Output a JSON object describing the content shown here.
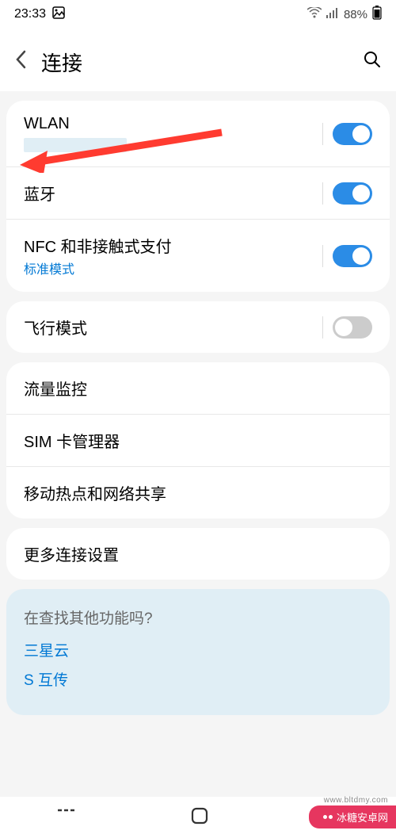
{
  "status_bar": {
    "time": "23:33",
    "battery_pct": "88%"
  },
  "header": {
    "title": "连接"
  },
  "settings": {
    "wlan": {
      "title": "WLAN",
      "enabled": true
    },
    "bluetooth": {
      "title": "蓝牙",
      "enabled": true
    },
    "nfc": {
      "title": "NFC 和非接触式支付",
      "subtitle": "标准模式",
      "enabled": true
    },
    "airplane": {
      "title": "飞行模式",
      "enabled": false
    },
    "data_usage": {
      "title": "流量监控"
    },
    "sim": {
      "title": "SIM 卡管理器"
    },
    "hotspot": {
      "title": "移动热点和网络共享"
    },
    "more_conn": {
      "title": "更多连接设置"
    }
  },
  "more_section": {
    "title": "在查找其他功能吗?",
    "link1": "三星云",
    "link2": "S 互传"
  },
  "watermark": {
    "text": "冰糖安卓网",
    "url": "www.bltdmy.com"
  }
}
